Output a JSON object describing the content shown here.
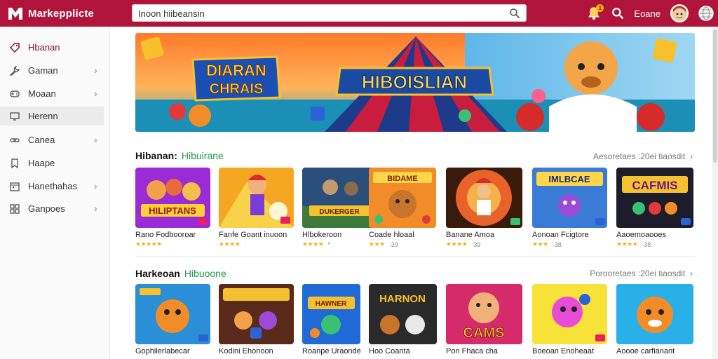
{
  "app": {
    "brand_name": "Markepplicte",
    "colors": {
      "topbar": "#b0143a",
      "accent_green": "#1f9a47",
      "star": "#f3b21b"
    }
  },
  "search": {
    "value": "Inoon hiibeansin"
  },
  "header": {
    "notification_badge": "1",
    "account_label": "Eoane"
  },
  "sidebar": {
    "items": [
      {
        "label": "Hbanan",
        "icon": "tag-icon",
        "chevron": false
      },
      {
        "label": "Gaman",
        "icon": "wrench-icon",
        "chevron": true
      },
      {
        "label": "Moaan",
        "icon": "controller-icon",
        "chevron": true
      },
      {
        "label": "Herenn",
        "icon": "monitor-icon",
        "chevron": false
      },
      {
        "label": "Canea",
        "icon": "link-icon",
        "chevron": true
      },
      {
        "label": "Haape",
        "icon": "bookmark-icon",
        "chevron": false
      },
      {
        "label": "Hanethahas",
        "icon": "calendar-icon",
        "chevron": true
      },
      {
        "label": "Ganpoes",
        "icon": "grid-icon",
        "chevron": true
      }
    ]
  },
  "banner": {
    "left_title": "DIARAN\nCHRAIS",
    "center_title": "HIBOISLIAN"
  },
  "sections": [
    {
      "title": "Hibanan:",
      "accent": "Hibuirane",
      "see_all": "Aesoretaes :20ei tiaosdit",
      "cards": [
        {
          "title": "Rano Fodbooroar",
          "art_text": "HILIPTANS",
          "stars": "★★★★★",
          "rating": ""
        },
        {
          "title": "Fanfe Goant inuoon",
          "art_text": "",
          "stars": "★★★★",
          "rating": "·"
        },
        {
          "title": "Hlbokeroon",
          "art_text": "DUKERGER",
          "stars": "★★★★",
          "rating": "*"
        },
        {
          "title": "Coade hloaal",
          "art_text": "BIDAME",
          "stars": "★★★",
          "rating": "·39"
        },
        {
          "title": "Banane Amoa",
          "art_text": "",
          "stars": "★★★★",
          "rating": "·39"
        },
        {
          "title": "Aonoan Fcigtore",
          "art_text": "IMLBCAE",
          "stars": "★★★",
          "rating": "·38"
        },
        {
          "title": "Aaoemoaooes",
          "art_text": "CAFMIS",
          "stars": "★★★★",
          "rating": "·38"
        }
      ]
    },
    {
      "title": "Harkeoan",
      "accent": "Hibuoone",
      "see_all": "Porooretaes :20ei tiaosdit",
      "cards": [
        {
          "title": "Gophilerlabecar",
          "art_text": "",
          "stars": "",
          "rating": ""
        },
        {
          "title": "Kodini Ehonoon",
          "art_text": "",
          "stars": "",
          "rating": ""
        },
        {
          "title": "Roanpe Uraonde",
          "art_text": "HAWNER",
          "stars": "",
          "rating": ""
        },
        {
          "title": "Hoo Coanta",
          "art_text": "HARNON",
          "stars": "",
          "rating": ""
        },
        {
          "title": "Pon Fhaca cha",
          "art_text": "CAMS",
          "stars": "",
          "rating": ""
        },
        {
          "title": "Boeoan Enoheaat",
          "art_text": "",
          "stars": "",
          "rating": ""
        },
        {
          "title": "Aoooe carfianant",
          "art_text": "",
          "stars": "",
          "rating": ""
        }
      ]
    }
  ]
}
